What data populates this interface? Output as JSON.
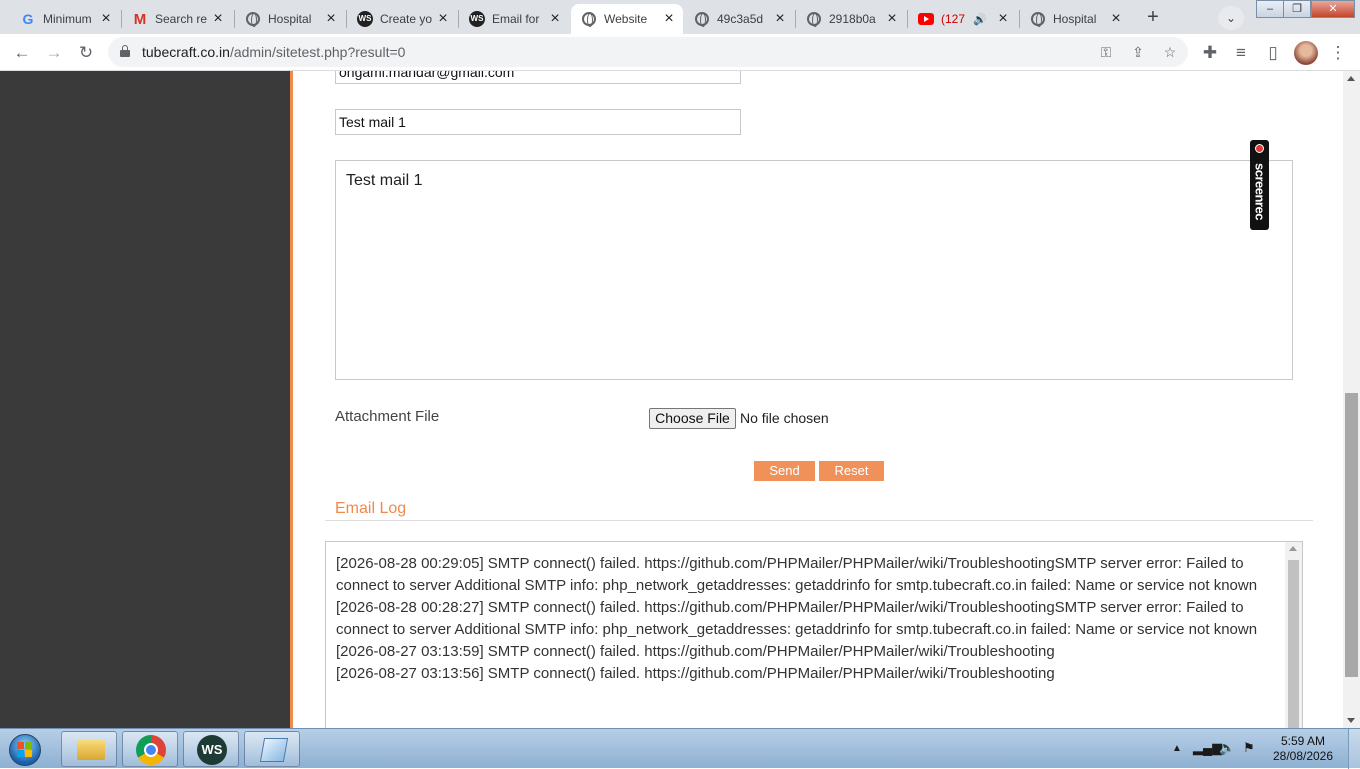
{
  "browser": {
    "tabs": [
      {
        "title": "Minimum",
        "favicon": "google-g-icon",
        "active": false
      },
      {
        "title": "Search re",
        "favicon": "gmail-icon",
        "active": false
      },
      {
        "title": "Hospital",
        "favicon": "globe-icon",
        "active": false
      },
      {
        "title": "Create yo",
        "favicon": "ws-logo-icon",
        "active": false
      },
      {
        "title": "Email for",
        "favicon": "ws-logo-icon",
        "active": false
      },
      {
        "title": "Website",
        "favicon": "globe-icon",
        "active": true
      },
      {
        "title": "49c3a5d",
        "favicon": "globe-icon",
        "active": false
      },
      {
        "title": "2918b0a",
        "favicon": "globe-icon",
        "active": false
      },
      {
        "title": "(127",
        "favicon": "youtube-icon",
        "active": false
      },
      {
        "title": "Hospital",
        "favicon": "globe-icon",
        "active": false
      }
    ],
    "address_bar": {
      "host": "tubecraft.co.in",
      "path": "/admin/sitetest.php?result=0"
    }
  },
  "form": {
    "to_value": "ongami.mandar@gmail.com",
    "subject_value": "Test mail 1",
    "message_value": "Test mail 1",
    "attachment_label": "Attachment File",
    "choose_file_label": "Choose File",
    "file_status": "No file chosen",
    "send_label": "Send",
    "reset_label": "Reset"
  },
  "email_log": {
    "heading": "Email Log",
    "entries": [
      "[2026-08-28 00:29:05] SMTP connect() failed. https://github.com/PHPMailer/PHPMailer/wiki/TroubleshootingSMTP server error: Failed to connect to server Additional SMTP info: php_network_getaddresses: getaddrinfo for smtp.tubecraft.co.in failed: Name or service not known",
      "[2026-08-28 00:28:27] SMTP connect() failed. https://github.com/PHPMailer/PHPMailer/wiki/TroubleshootingSMTP server error: Failed to connect to server Additional SMTP info: php_network_getaddresses: getaddrinfo for smtp.tubecraft.co.in failed: Name or service not known",
      "[2026-08-27 03:13:59] SMTP connect() failed. https://github.com/PHPMailer/PHPMailer/wiki/Troubleshooting",
      "[2026-08-27 03:13:56] SMTP connect() failed. https://github.com/PHPMailer/PHPMailer/wiki/Troubleshooting"
    ]
  },
  "overlay": {
    "screenrec_label": "screenrec"
  },
  "taskbar": {
    "clock_time": "5:59 AM",
    "clock_date": "28/08/2026",
    "pinned": [
      "file-explorer-icon",
      "chrome-icon",
      "ws-app-icon",
      "notepad-icon"
    ]
  },
  "colors": {
    "accent_orange": "#f08a4b",
    "button_orange": "#f0915a",
    "sidebar_dark": "#3a3a3a"
  }
}
